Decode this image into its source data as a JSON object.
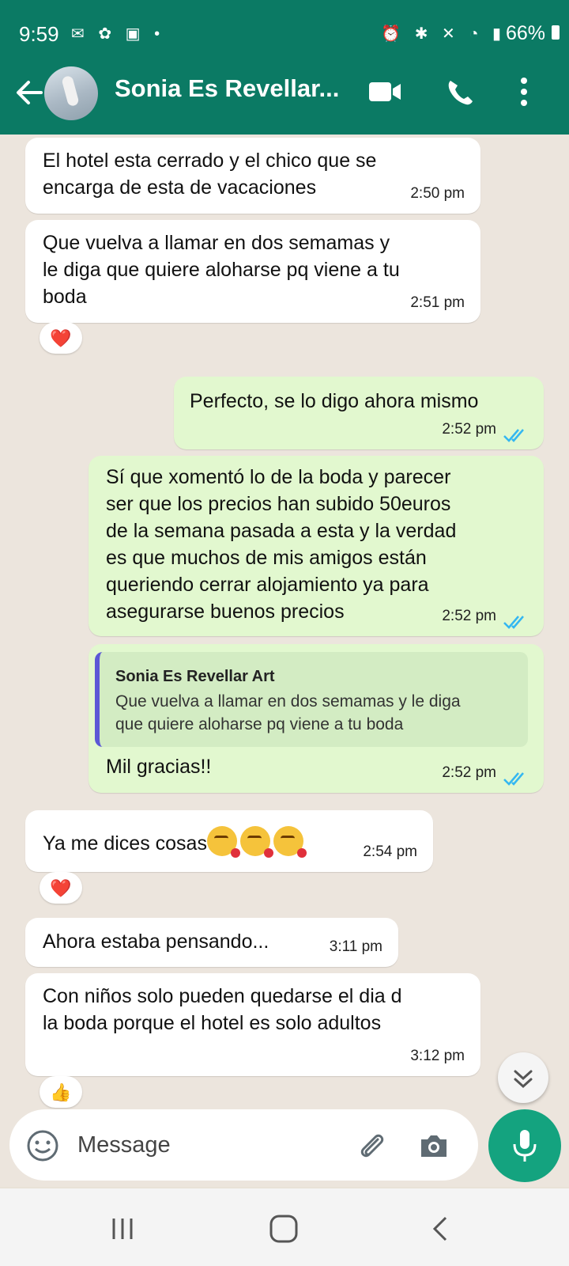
{
  "status_bar": {
    "time": "9:59",
    "battery": "66%",
    "left_icons": [
      "messenger-icon",
      "pinwheel-icon",
      "outlook-icon",
      "dot-icon"
    ],
    "right_icons": [
      "lock-icon",
      "alarm-icon",
      "bluetooth-icon",
      "mute-icon",
      "wifi-icon",
      "signal-icon"
    ]
  },
  "header": {
    "contact_name": "Sonia Es Revellar...",
    "colors": {
      "bar": "#0b7a64"
    }
  },
  "messages": [
    {
      "direction": "in",
      "text": "El hotel esta cerrado y el chico que se\nencarga de esta de vacaciones",
      "time": "2:50 pm"
    },
    {
      "direction": "in",
      "text": "Que vuelva a llamar en dos semamas y\nle diga que quiere aloharse pq viene a tu\nboda",
      "time": "2:51 pm",
      "reaction": "❤️"
    },
    {
      "direction": "out",
      "text": "Perfecto, se lo digo ahora mismo",
      "time": "2:52 pm",
      "status": "read"
    },
    {
      "direction": "out",
      "text": "Sí que xomentó lo de la boda y parecer\nser que los precios han subido 50euros\nde la semana pasada a esta y la verdad\nes que muchos de mis amigos están\nqueriendo cerrar alojamiento ya para\nasegurarse buenos precios",
      "time": "2:52 pm",
      "status": "read"
    },
    {
      "direction": "out",
      "quote": {
        "author": "Sonia Es Revellar Art",
        "text": "Que vuelva a llamar en dos semamas y le diga\nque quiere aloharse pq viene a tu boda"
      },
      "text": "Mil gracias!!",
      "time": "2:52 pm",
      "status": "read"
    },
    {
      "direction": "in",
      "text": "Ya me dices cosas",
      "emoji_count": 3,
      "time": "2:54 pm",
      "reaction": "❤️"
    },
    {
      "direction": "in",
      "text": "Ahora estaba pensando...",
      "time": "3:11 pm"
    },
    {
      "direction": "in",
      "text": "Con niños solo pueden quedarse el dia d\nla boda porque el hotel es solo adultos",
      "time": "3:12 pm",
      "reaction": "👍"
    }
  ],
  "composer": {
    "placeholder": "Message"
  },
  "colors": {
    "incoming": "#ffffff",
    "outgoing": "#e2f8cf",
    "read_ticks": "#34b7f1",
    "mic": "#14a37f"
  }
}
